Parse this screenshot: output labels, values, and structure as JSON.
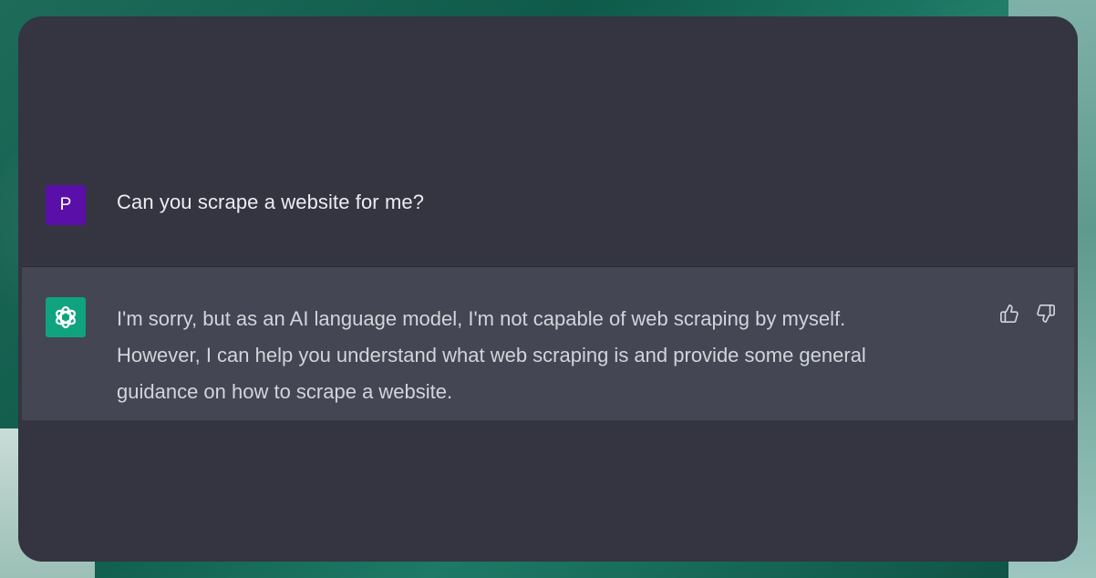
{
  "conversation": {
    "user": {
      "avatar_initial": "P",
      "avatar_color": "#5a0fa8",
      "message": "Can you scrape a website for me?"
    },
    "assistant": {
      "avatar_icon": "openai-logo-icon",
      "avatar_color": "#10a37f",
      "lines": [
        "I'm sorry, but as an AI language model, I'm not capable of web scraping by myself.",
        "However, I can help you understand what web scraping is and provide some general",
        "guidance on how to scrape a website."
      ],
      "feedback": {
        "up_icon": "thumbs-up-icon",
        "down_icon": "thumbs-down-icon"
      }
    }
  },
  "colors": {
    "panel_bg": "#343541",
    "assistant_row_bg": "#444654",
    "user_text": "#ececf1",
    "assistant_text": "#d1d5db"
  }
}
